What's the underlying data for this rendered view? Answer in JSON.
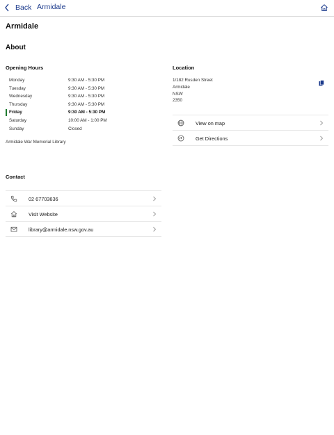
{
  "nav": {
    "back_label": "Back",
    "title": "Armidale"
  },
  "page": {
    "title": "Armidale",
    "about_label": "About"
  },
  "opening_hours": {
    "title": "Opening Hours",
    "rows": [
      {
        "day": "Monday",
        "time": "9:30 AM - 5:30 PM"
      },
      {
        "day": "Tuesday",
        "time": "9:30 AM - 5:30 PM"
      },
      {
        "day": "Wednesday",
        "time": "9:30 AM - 5:30 PM"
      },
      {
        "day": "Thursday",
        "time": "9:30 AM - 5:30 PM"
      },
      {
        "day": "Friday",
        "time": "9:30 AM - 5:30 PM",
        "today": true
      },
      {
        "day": "Saturday",
        "time": "10:00 AM - 1:00 PM"
      },
      {
        "day": "Sunday",
        "time": "Closed"
      }
    ],
    "library_name": "Armidale War Memorial Library"
  },
  "location": {
    "title": "Location",
    "address_lines": [
      "1/182 Rusden Street",
      "Armidale",
      "NSW",
      "2350"
    ],
    "actions": [
      {
        "label": "View on map",
        "icon": "globe-icon"
      },
      {
        "label": "Get Directions",
        "icon": "directions-icon"
      }
    ]
  },
  "contact": {
    "title": "Contact",
    "items": [
      {
        "label": "02 67703636",
        "icon": "phone-icon"
      },
      {
        "label": "Visit Website",
        "icon": "home-icon"
      },
      {
        "label": "library@armidale.nsw.gov.au",
        "icon": "mail-icon"
      }
    ]
  },
  "colors": {
    "accent": "#1b3a8c",
    "today_marker": "#1e7b2f",
    "divider": "#e6e6e6"
  }
}
